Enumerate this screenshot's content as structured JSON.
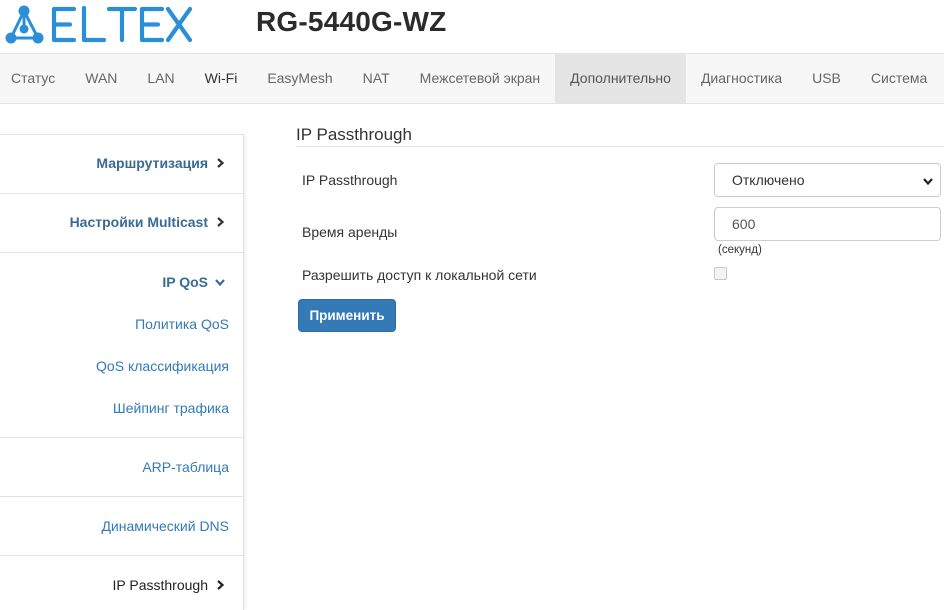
{
  "header": {
    "logo_text": "ELTEX",
    "model": "RG-5440G-WZ",
    "brand_color": "#2a8fd6"
  },
  "topnav": [
    {
      "label": "Статус",
      "active": false
    },
    {
      "label": "WAN",
      "active": false
    },
    {
      "label": "LAN",
      "active": false
    },
    {
      "label": "Wi-Fi",
      "active": false
    },
    {
      "label": "EasyMesh",
      "active": false
    },
    {
      "label": "NAT",
      "active": false
    },
    {
      "label": "Межсетевой экран",
      "active": false
    },
    {
      "label": "Дополнительно",
      "active": true
    },
    {
      "label": "Диагностика",
      "active": false
    },
    {
      "label": "USB",
      "active": false
    },
    {
      "label": "Система",
      "active": false
    }
  ],
  "sidebar": {
    "routing": "Маршрутизация",
    "multicast": "Настройки Multicast",
    "ipqos": "IP QoS",
    "ipqos_items": [
      "Политика QoS",
      "QoS классификация",
      "Шейпинг трафика"
    ],
    "arp": "ARP-таблица",
    "ddns": "Динамический DNS",
    "ip_passthrough": "IP Passthrough"
  },
  "main": {
    "title": "IP Passthrough",
    "passthrough_label": "IP Passthrough",
    "passthrough_value": "Отключено",
    "lease_label": "Время аренды",
    "lease_value": "600",
    "lease_hint": "(секунд)",
    "lan_access_label": "Разрешить доступ к локальной сети",
    "lan_access_checked": false,
    "apply_label": "Применить"
  },
  "colors": {
    "link": "#337ab7",
    "button": "#337ab7",
    "nav_active_bg": "#e5e5e5"
  }
}
